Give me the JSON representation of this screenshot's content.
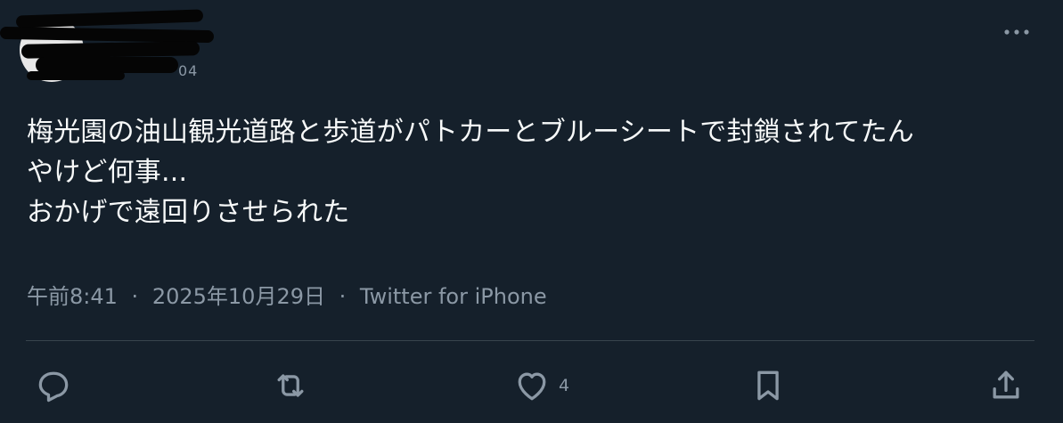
{
  "colors": {
    "background": "#15202b",
    "text_primary": "#f7f9f9",
    "text_secondary": "#8b98a5",
    "divider": "#38444d"
  },
  "header": {
    "handle_visible_fragment": "04",
    "more_icon": "more-horizontal-icon"
  },
  "tweet": {
    "lines": [
      "梅光園の油山観光道路と歩道がパトカーとブルーシートで封鎖されてたん",
      "やけど何事...",
      "おかげで遠回りさせられた"
    ]
  },
  "meta": {
    "time": "午前8:41",
    "separator": "·",
    "date": "2025年10月29日",
    "source": "Twitter for iPhone"
  },
  "actions": {
    "reply_icon": "reply-icon",
    "retweet_icon": "retweet-icon",
    "like_icon": "heart-icon",
    "like_count": "4",
    "bookmark_icon": "bookmark-icon",
    "share_icon": "share-icon"
  }
}
